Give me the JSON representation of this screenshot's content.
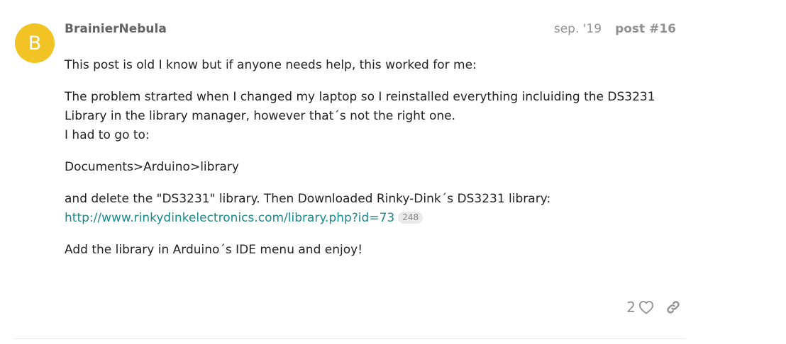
{
  "post": {
    "avatar_letter": "B",
    "avatar_color": "#f2c324",
    "username": "BrainierNebula",
    "date": "sep. '19",
    "post_number": "post #16",
    "paragraphs": {
      "p1": "This post is old I know but if anyone needs help, this worked for me:",
      "p2_line1": "The problem strarted when I changed my laptop so I reinstalled everything incluiding the DS3231",
      "p2_line2": "Library in the library manager, however that´s not the right one.",
      "p2_line3": "I had to go to:",
      "p3": "Documents>Arduino>library",
      "p4_text": "and delete the \"DS3231\" library. Then Downloaded Rinky-Dink´s DS3231 library:",
      "p4_link": "http://www.rinkydinkelectronics.com/library.php?id=73",
      "p4_link_clicks": "248",
      "p5": "Add the library in Arduino´s IDE menu and enjoy!"
    },
    "like_count": "2",
    "link_color": "#1a8a8a",
    "icons": {
      "like": "heart-icon",
      "share": "link-icon"
    }
  }
}
